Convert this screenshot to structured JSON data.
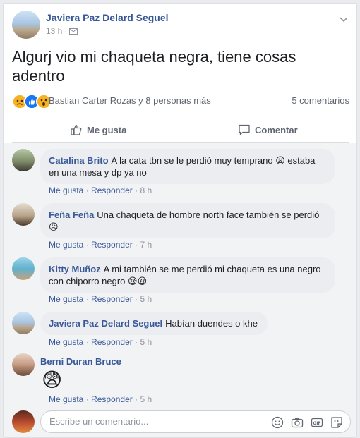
{
  "post": {
    "author": "Javiera Paz Delard Seguel",
    "time": "13 h",
    "separator": "·",
    "text": "Algurj vio mi chaqueta negra, tiene cosas adentro"
  },
  "reactions": {
    "icons": [
      "sad-icon",
      "like-icon",
      "wow-icon"
    ],
    "likers_text": "Bastian Carter Rozas y 8 personas más",
    "comments_count": "5 comentarios"
  },
  "actions": {
    "like_label": "Me gusta",
    "comment_label": "Comentar"
  },
  "comments": [
    {
      "name": "Catalina Brito",
      "text": "A la cata tbn se le perdió muy temprano 😦 estaba en una mesa y dp ya no",
      "like": "Me gusta",
      "dot": "·",
      "reply": "Responder",
      "time": "8 h"
    },
    {
      "name": "Feña Feña",
      "text": "Una chaqueta de hombre north face también se perdió 😥",
      "like": "Me gusta",
      "dot": "·",
      "reply": "Responder",
      "time": "7 h"
    },
    {
      "name": "Kitty Muñoz",
      "text": "A mi también se me perdió mi chaqueta es una negro con chiporro negro 😪😪",
      "like": "Me gusta",
      "dot": "·",
      "reply": "Responder",
      "time": "5 h"
    },
    {
      "name": "Javiera Paz Delard Seguel",
      "text": "Habían duendes o khe",
      "like": "Me gusta",
      "dot": "·",
      "reply": "Responder",
      "time": "5 h"
    },
    {
      "name": "Berni Duran Bruce",
      "text": "😨",
      "like": "Me gusta",
      "dot": "·",
      "reply": "Responder",
      "time": "5 h"
    }
  ],
  "composer": {
    "placeholder": "Escribe un comentario..."
  },
  "colors": {
    "link": "#385898",
    "muted": "#90949c",
    "bubble": "#ebedf0"
  }
}
